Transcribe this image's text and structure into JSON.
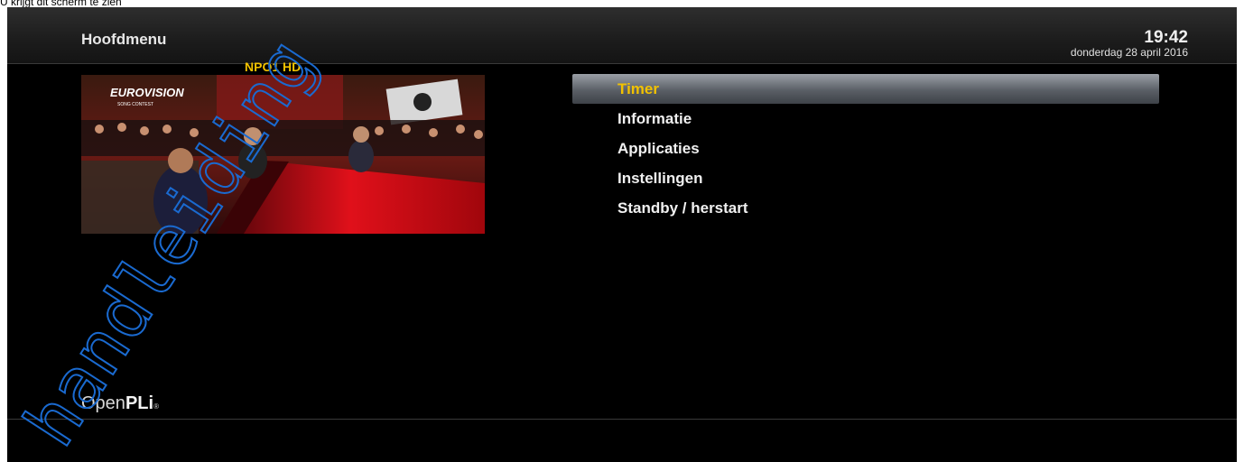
{
  "caption": "U krijgt dit scherm te zien",
  "header": {
    "title": "Hoofdmenu",
    "time": "19:42",
    "date": "donderdag 28 april 2016"
  },
  "preview": {
    "channel": "NPO1 HD",
    "overlay_logo": "EUROVISION",
    "overlay_sub": "SONG CONTEST"
  },
  "menu": {
    "items": [
      {
        "label": "Timer",
        "selected": true
      },
      {
        "label": "Informatie",
        "selected": false
      },
      {
        "label": "Applicaties",
        "selected": false
      },
      {
        "label": "Instellingen",
        "selected": false
      },
      {
        "label": "Standby / herstart",
        "selected": false
      }
    ]
  },
  "footer": {
    "brand_light": "Open",
    "brand_bold": "PLi",
    "brand_mark": "®"
  },
  "watermark": "handleiding"
}
